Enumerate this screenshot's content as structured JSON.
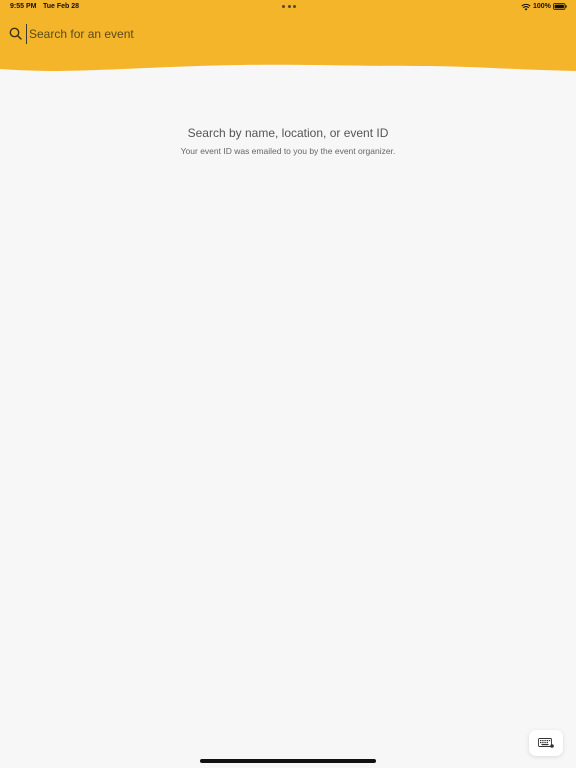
{
  "colors": {
    "accent": "#f5b52a",
    "background": "#f7f7f7"
  },
  "status_bar": {
    "time": "9:55 PM",
    "date": "Tue Feb 28",
    "battery": "100%",
    "icons": [
      "multitasking-dots-icon",
      "wifi-icon",
      "battery-icon"
    ]
  },
  "search": {
    "icon": "search-icon",
    "placeholder": "Search for an event",
    "value": ""
  },
  "empty_state": {
    "title": "Search by name, location, or event ID",
    "subtitle": "Your event ID was emailed to you by the event organizer."
  },
  "keyboard_button": {
    "icon": "keyboard-icon"
  }
}
